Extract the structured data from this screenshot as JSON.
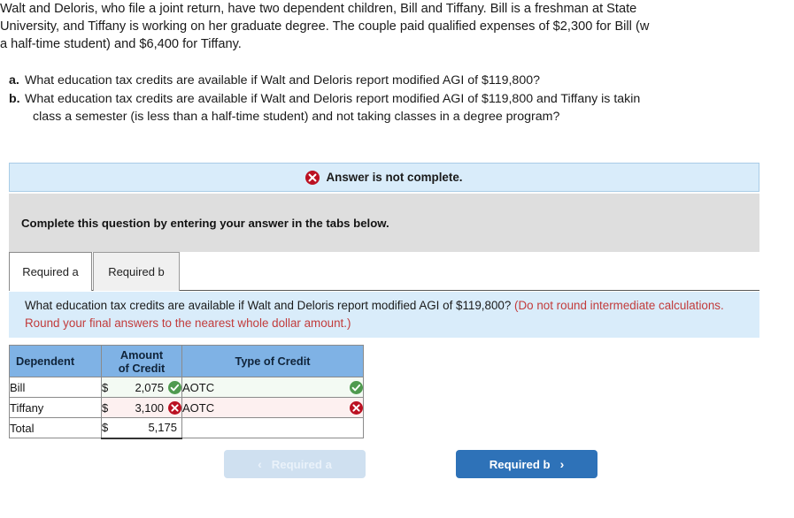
{
  "problem": {
    "lines": [
      "Walt and Deloris, who file a joint return, have two dependent children, Bill and Tiffany. Bill is a freshman at State",
      "University, and Tiffany is working on her graduate degree. The couple paid qualified expenses of $2,300 for Bill (w",
      "a half-time student) and $6,400 for Tiffany."
    ]
  },
  "requirements": [
    {
      "label": "a.",
      "text": "What education tax credits are available if Walt and Deloris report modified AGI of $119,800?",
      "continuation": ""
    },
    {
      "label": "b.",
      "text": "What education tax credits are available if Walt and Deloris report modified AGI of $119,800 and Tiffany is takin",
      "continuation": "class a semester (is less than a half-time student) and not taking classes in a degree program?"
    }
  ],
  "alert": {
    "icon": "error-x-icon",
    "text": "Answer is not complete."
  },
  "instruction": {
    "text": "Complete this question by entering your answer in the tabs below."
  },
  "tabs": [
    {
      "label": "Required a",
      "active": true
    },
    {
      "label": "Required b",
      "active": false
    }
  ],
  "prompt": {
    "question": "What education tax credits are available if Walt and Deloris report modified AGI of $119,800? ",
    "note": "(Do not round intermediate calculations. Round your final answers to the nearest whole dollar amount.)"
  },
  "table": {
    "headers": {
      "dependent": "Dependent",
      "amount_line1": "Amount",
      "amount_line2": "of Credit",
      "type": "Type of Credit"
    },
    "rows": [
      {
        "name": "Bill",
        "currency": "$",
        "amount": "2,075",
        "amount_status": "correct",
        "type": "AOTC",
        "type_status": "correct"
      },
      {
        "name": "Tiffany",
        "currency": "$",
        "amount": "3,100",
        "amount_status": "wrong",
        "type": "AOTC",
        "type_status": "wrong"
      },
      {
        "name": "Total",
        "currency": "$",
        "amount": "5,175",
        "amount_status": "none",
        "type": "",
        "type_status": "none"
      }
    ]
  },
  "nav": {
    "prev_label": "Required a",
    "prev_chevron": "‹",
    "next_label": "Required b",
    "next_chevron": "›"
  },
  "colors": {
    "banner_blue": "#d9ecfa",
    "banner_border": "#a9cce6",
    "instruction_grey": "#dedede",
    "table_header_blue": "#7fb2e5",
    "correct_green": "#4f9a4f",
    "error_red": "#bb1122",
    "note_red": "#c23b3b",
    "primary_button": "#2e72b8",
    "disabled_button": "#cfe0f0"
  }
}
